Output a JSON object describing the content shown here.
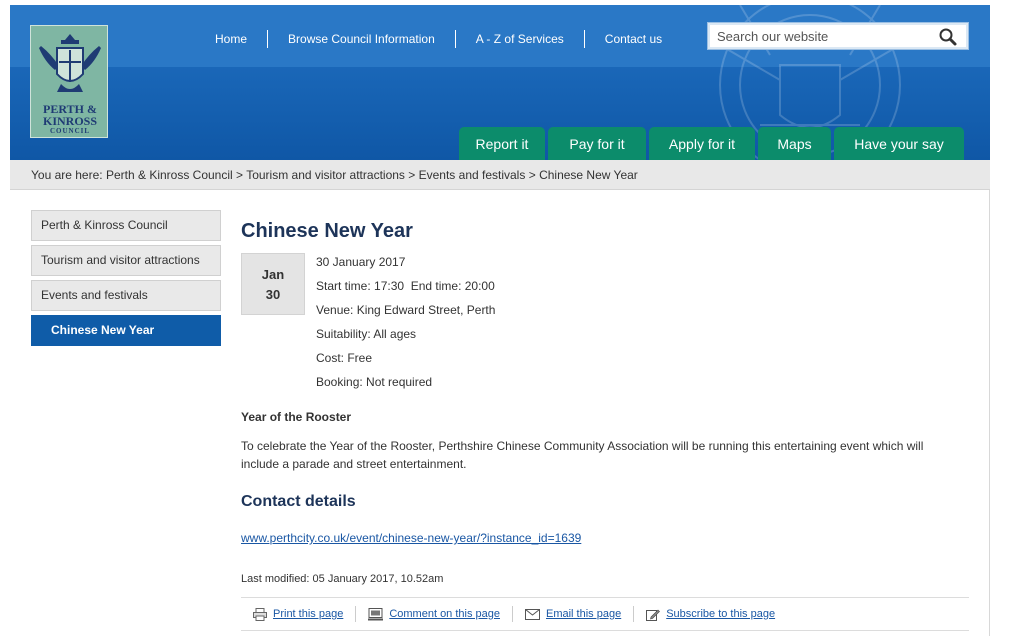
{
  "header": {
    "logo": {
      "line1": "PERTH &",
      "line2": "KINROSS",
      "line3": "COUNCIL"
    },
    "topnav": [
      "Home",
      "Browse Council Information",
      "A - Z of Services",
      "Contact us"
    ],
    "search": {
      "placeholder": "Search our website"
    },
    "tabs": [
      "Report it",
      "Pay for it",
      "Apply for it",
      "Maps",
      "Have your say"
    ]
  },
  "breadcrumb": {
    "prefix": "You are here:",
    "items": [
      "Perth & Kinross Council",
      "Tourism and visitor attractions",
      "Events and festivals",
      "Chinese New Year"
    ],
    "separator": ">"
  },
  "sidebar": {
    "items": [
      "Perth & Kinross Council",
      "Tourism and visitor attractions",
      "Events and festivals",
      "Chinese New Year"
    ],
    "active_index": 3
  },
  "event": {
    "title": "Chinese New Year",
    "date_month": "Jan",
    "date_day": "30",
    "date": "30 January 2017",
    "times": "Start time: 17:30  End time: 20:00",
    "venue": "Venue: King Edward Street, Perth",
    "suitability": "Suitability: All ages",
    "cost": "Cost: Free",
    "booking": "Booking: Not required",
    "subheading": "Year of the Rooster",
    "description": "To celebrate the Year of the Rooster, Perthshire Chinese Community Association will be running this entertaining event which will include a parade and street entertainment.",
    "contact_heading": "Contact details",
    "contact_link": "www.perthcity.co.uk/event/chinese-new-year/?instance_id=1639",
    "last_modified": "Last modified: 05 January 2017, 10.52am"
  },
  "actions": [
    "Print this page",
    "Comment on this page",
    "Email this page",
    "Subscribe to this page"
  ],
  "colors": {
    "header_blue": "#1a67b8",
    "tab_green": "#0c8c6b",
    "active_sidebar": "#0f5ca8",
    "title": "#1d3459",
    "link": "#1a57a4"
  }
}
